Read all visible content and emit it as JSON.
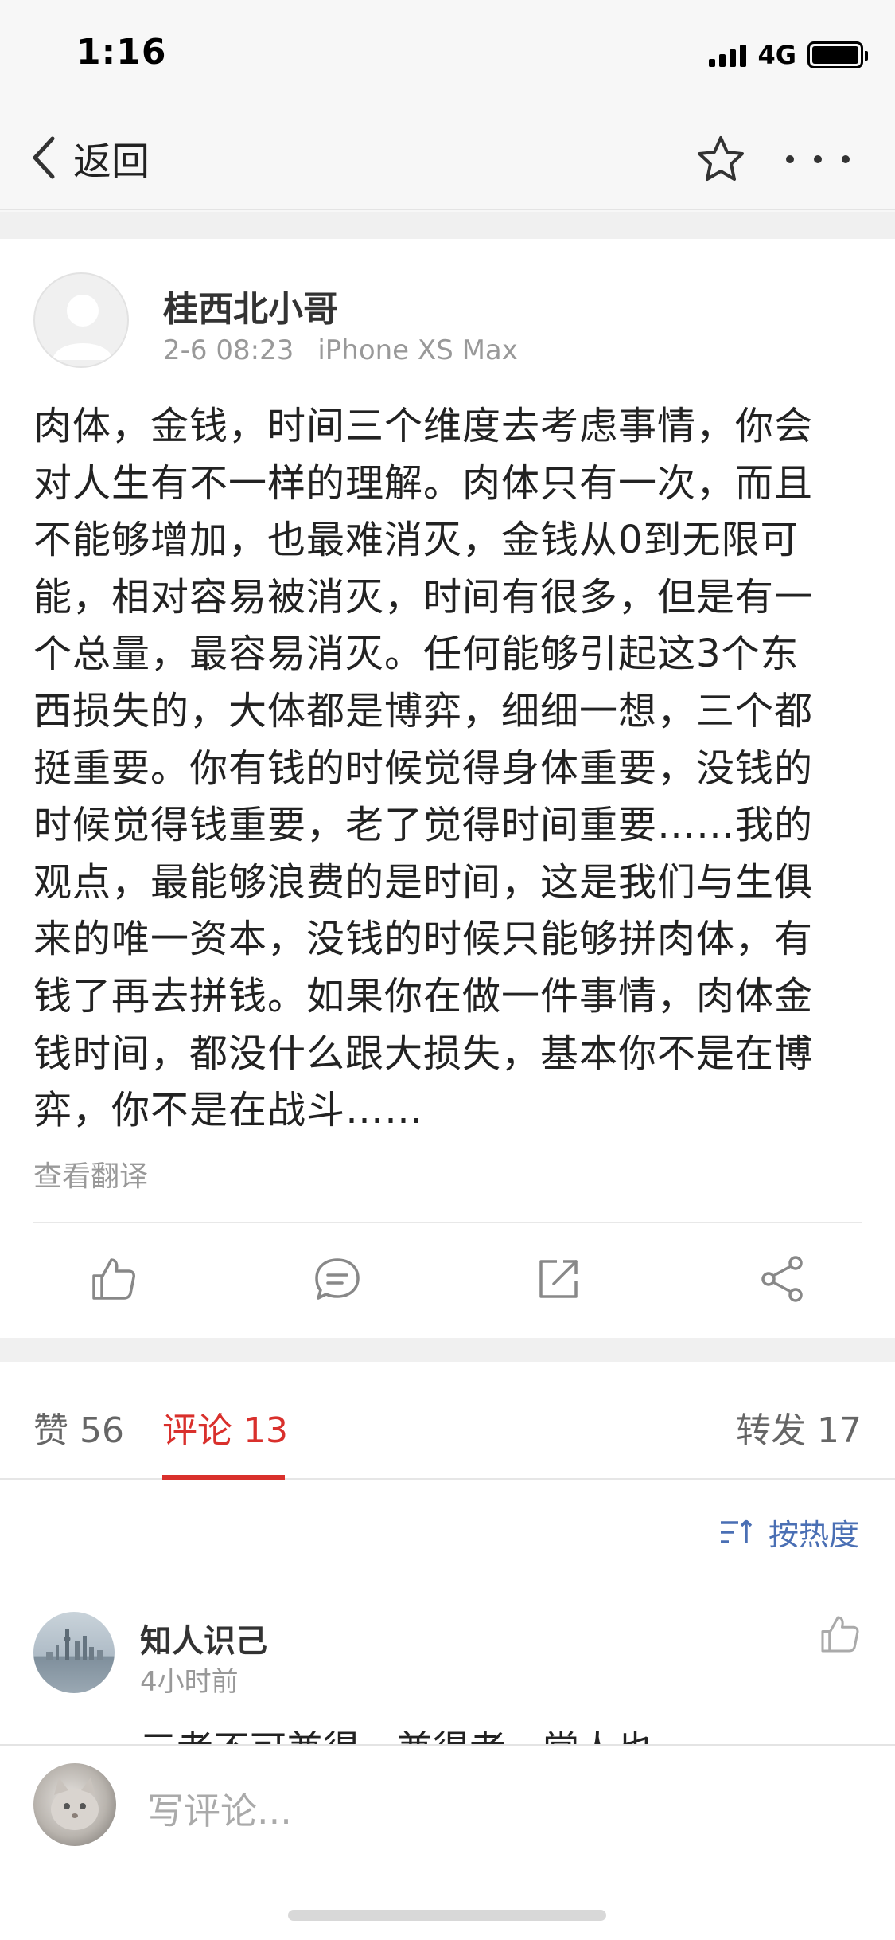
{
  "status_bar": {
    "time": "1:16",
    "network": "4G"
  },
  "nav": {
    "back_label": "返回"
  },
  "post": {
    "author": "桂西北小哥",
    "date": "2-6 08:23",
    "device": "iPhone XS Max",
    "lines": [
      "肉体，金钱，时间三个维度去考虑事情，你会",
      "对人生有不一样的理解。肉体只有一次，而且",
      "不能够增加，也最难消灭，金钱从0到无限可",
      "能，相对容易被消灭，时间有很多，但是有一",
      "个总量，最容易消灭。任何能够引起这3个东",
      "西损失的，大体都是博弈，细细一想，三个都",
      "挺重要。你有钱的时候觉得身体重要，没钱的",
      "时候觉得钱重要，老了觉得时间重要……我的",
      "观点，最能够浪费的是时间，这是我们与生俱",
      "来的唯一资本，没钱的时候只能够拼肉体，有",
      "钱了再去拼钱。如果你在做一件事情，肉体金",
      "钱时间，都没什么跟大损失，基本你不是在博",
      "弈，你不是在战斗……"
    ],
    "translate_label": "查看翻译"
  },
  "actions": {
    "like_icon": "thumbs-up-icon",
    "comment_icon": "comment-icon",
    "repost_icon": "repost-icon",
    "share_icon": "share-icon"
  },
  "tabs": {
    "likes": "赞 56",
    "comments": "评论 13",
    "reposts": "转发 17"
  },
  "sort_label": "按热度",
  "comment": {
    "name": "知人识己",
    "time": "4小时前",
    "text": "三者不可兼得，兼得者，常人也"
  },
  "input": {
    "placeholder": "写评论..."
  },
  "colors": {
    "accent": "#d9302c",
    "link": "#4a6fb4",
    "muted": "#999999"
  }
}
